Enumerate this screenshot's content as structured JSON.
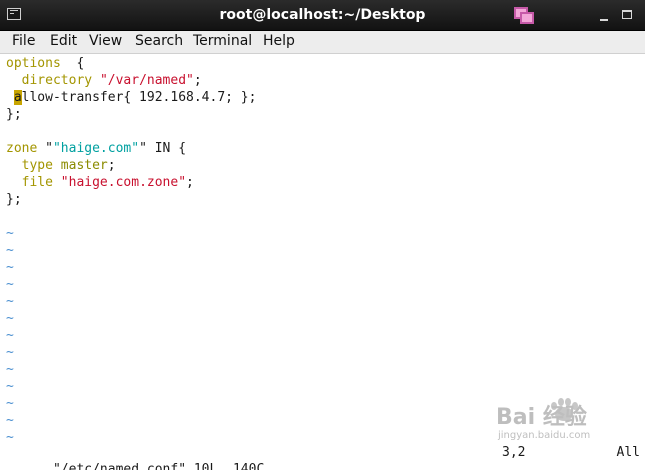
{
  "window": {
    "title": "root@localhost:~/Desktop"
  },
  "icons": {
    "app": "terminal-icon",
    "restore": "restore-window-icon",
    "minimize": "minimize-icon",
    "maximize": "maximize-icon"
  },
  "menu": [
    "File",
    "Edit",
    "View",
    "Search",
    "Terminal",
    "Help"
  ],
  "editor": {
    "line1": {
      "kw": "options",
      "rest": "  {"
    },
    "line2": {
      "indent": "  ",
      "kw": "directory",
      "str": "\"/var/named\"",
      "end": ";"
    },
    "line3": {
      "cursor": "a",
      "rest": "llow-transfer{ 192.168.4.7; };"
    },
    "line4": "};",
    "line6": {
      "kw": "zone",
      "str": "\"haige.com\"",
      "rest": " IN {"
    },
    "line7": {
      "indent": "  ",
      "kw": "type",
      "val": " master",
      "end": ";"
    },
    "line8": {
      "indent": "  ",
      "kw": "file",
      "str": "\"haige.com.zone\"",
      "end": ";"
    },
    "line9": "};",
    "tilde": "~"
  },
  "status": {
    "file": "\"/etc/named.conf\" 10L, 140C",
    "position": "3,2",
    "scroll": "All"
  },
  "watermark": {
    "text": "Bai 经验",
    "sub": "jingyan.baidu.com"
  }
}
